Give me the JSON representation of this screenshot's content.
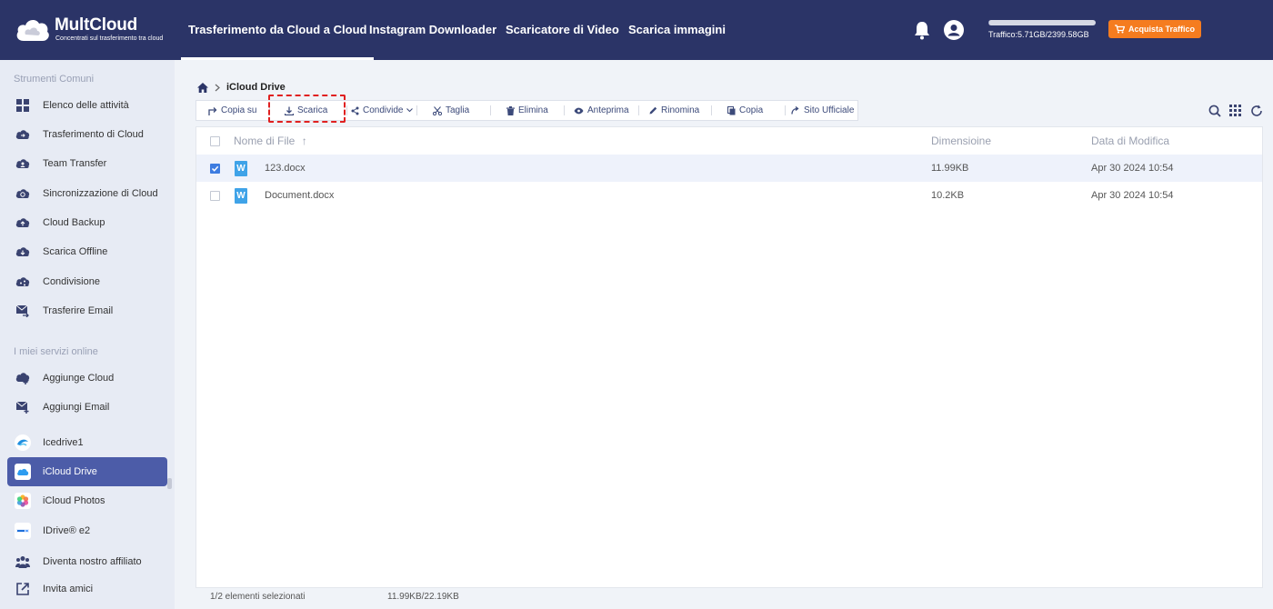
{
  "brand": {
    "name": "MultCloud",
    "tagline": "Concentrati sul trasferimento tra cloud"
  },
  "nav": [
    {
      "label": "Trasferimento da Cloud a Cloud",
      "active": true
    },
    {
      "label": "Instagram Downloader"
    },
    {
      "label": "Scaricatore di Video"
    },
    {
      "label": "Scarica immagini"
    }
  ],
  "header": {
    "traffic_text": "Traffico:5.71GB/2399.58GB",
    "traffic_used_fraction": 0.0024,
    "buy_label": "Acquista Traffico",
    "icons": [
      "bell-icon",
      "user-icon",
      "cart-icon"
    ]
  },
  "sidebar": {
    "section_tools": "Strumenti Comuni",
    "tools": [
      {
        "label": "Elenco delle attività",
        "icon": "grid-icon"
      },
      {
        "label": "Trasferimento di Cloud",
        "icon": "cloud-transfer-icon"
      },
      {
        "label": "Team Transfer",
        "icon": "team-transfer-icon"
      },
      {
        "label": "Sincronizzazione di Cloud",
        "icon": "cloud-sync-icon"
      },
      {
        "label": "Cloud Backup",
        "icon": "cloud-backup-icon"
      },
      {
        "label": "Scarica Offline",
        "icon": "offline-download-icon"
      },
      {
        "label": "Condivisione",
        "icon": "share-icon"
      },
      {
        "label": "Trasferire Email",
        "icon": "email-transfer-icon"
      }
    ],
    "section_services": "I miei servizi online",
    "services": [
      {
        "label": "Aggiunge Cloud",
        "icon": "add-cloud-icon"
      },
      {
        "label": "Aggiungi Email",
        "icon": "add-email-icon"
      },
      {
        "label": "Icedrive1",
        "icon": "icedrive-icon"
      },
      {
        "label": "iCloud Drive",
        "icon": "icloud-drive-icon",
        "active": true
      },
      {
        "label": "iCloud Photos",
        "icon": "icloud-photos-icon"
      },
      {
        "label": "IDrive® e2",
        "icon": "idrive-e2-icon"
      },
      {
        "label": "Diventa nostro affiliato",
        "icon": "affiliate-icon"
      },
      {
        "label": "Invita amici",
        "icon": "invite-icon"
      }
    ]
  },
  "breadcrumb": {
    "current": "iCloud Drive"
  },
  "toolbar": {
    "copy_to": "Copia su",
    "download": "Scarica",
    "share": "Condivide",
    "cut": "Taglia",
    "delete": "Elimina",
    "preview": "Anteprima",
    "rename": "Rinomina",
    "copy": "Copia",
    "official_site": "Sito Ufficiale"
  },
  "table": {
    "headers": {
      "name": "Nome di File",
      "size": "Dimensioine",
      "date": "Data di Modifica"
    },
    "rows": [
      {
        "name": "123.docx",
        "size": "11.99KB",
        "date": "Apr 30 2024 10:54",
        "selected": true,
        "icon": "word-icon"
      },
      {
        "name": "Document.docx",
        "size": "10.2KB",
        "date": "Apr 30 2024 10:54",
        "selected": false,
        "icon": "word-icon"
      }
    ]
  },
  "status": {
    "selected": "1/2 elementi selezionati",
    "size": "11.99KB/22.19KB"
  },
  "colors": {
    "topbar": "#2b3467",
    "sidebar": "#e7ebf4",
    "active_item": "#4c5ca8",
    "buy_button": "#f57c1f",
    "highlight": "#e02020",
    "checkbox_on": "#3d7ce0"
  }
}
